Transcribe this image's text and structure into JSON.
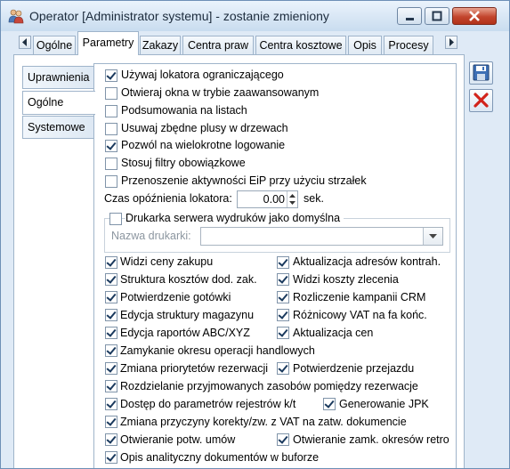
{
  "window": {
    "title": "Operator [Administrator systemu] - zostanie zmieniony"
  },
  "tabs": [
    "Ogólne",
    "Parametry",
    "Zakazy",
    "Centra praw",
    "Centra kosztowe",
    "Opis",
    "Procesy"
  ],
  "active_tab": "Parametry",
  "side_tabs": [
    "Uprawnienia",
    "Ogólne",
    "Systemowe"
  ],
  "active_side_tab": "Ogólne",
  "options_top": [
    {
      "label": "Używaj lokatora ograniczającego",
      "checked": true
    },
    {
      "label": "Otwieraj okna w trybie zaawansowanym",
      "checked": false
    },
    {
      "label": "Podsumowania na listach",
      "checked": false
    },
    {
      "label": "Usuwaj zbędne plusy w drzewach",
      "checked": false
    },
    {
      "label": "Pozwól na wielokrotne logowanie",
      "checked": true
    },
    {
      "label": "Stosuj filtry obowiązkowe",
      "checked": false
    },
    {
      "label": "Przenoszenie aktywności EiP przy użyciu strzałek",
      "checked": false
    }
  ],
  "locator_delay": {
    "label": "Czas opóźnienia lokatora:",
    "value": "0.00",
    "unit": "sek."
  },
  "printer": {
    "checkbox_label": "Drukarka serwera wydruków jako domyślna",
    "checked": false,
    "name_label": "Nazwa drukarki:",
    "name_value": ""
  },
  "permissions": [
    {
      "label": "Widzi ceny zakupu",
      "checked": true
    },
    {
      "label": "Aktualizacja adresów kontrah.",
      "checked": true
    },
    {
      "label": "Struktura kosztów dod. zak.",
      "checked": true
    },
    {
      "label": "Widzi koszty zlecenia",
      "checked": true
    },
    {
      "label": "Potwierdzenie gotówki",
      "checked": true
    },
    {
      "label": "Rozliczenie kampanii CRM",
      "checked": true
    },
    {
      "label": "Edycja struktury magazynu",
      "checked": true
    },
    {
      "label": "Różnicowy VAT na fa końc.",
      "checked": true
    },
    {
      "label": "Edycja raportów ABC/XYZ",
      "checked": true
    },
    {
      "label": "Aktualizacja cen",
      "checked": true
    },
    {
      "label": "Zamykanie okresu operacji handlowych",
      "checked": true
    },
    {
      "label": "Zmiana priorytetów rezerwacji",
      "checked": true
    },
    {
      "label": "Potwierdzenie przejazdu",
      "checked": true
    },
    {
      "label": "Rozdzielanie przyjmowanych zasobów pomiędzy rezerwacje",
      "checked": true
    },
    {
      "label": "Dostęp do parametrów rejestrów k/t",
      "checked": true
    },
    {
      "label": "Generowanie JPK",
      "checked": true
    },
    {
      "label": "Zmiana przyczyny korekty/zw. z VAT na zatw. dokumencie",
      "checked": true
    },
    {
      "label": "Otwieranie potw. umów",
      "checked": true
    },
    {
      "label": "Otwieranie zamk. okresów retro",
      "checked": true
    },
    {
      "label": "Opis analityczny dokumentów w buforze",
      "checked": true
    }
  ]
}
